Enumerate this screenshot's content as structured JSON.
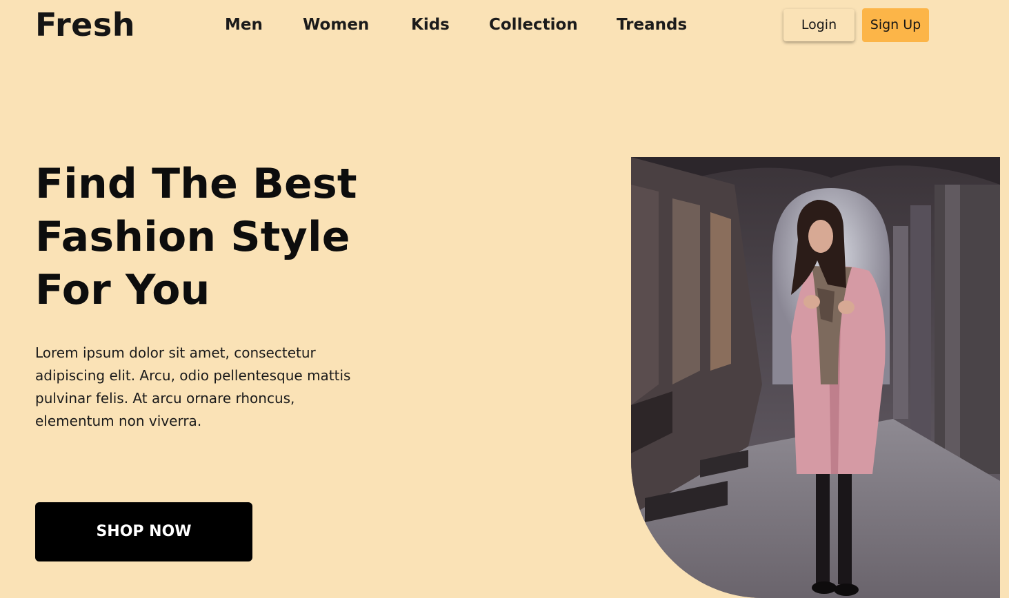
{
  "brand": {
    "logo_text": "Fresh"
  },
  "nav": {
    "items": [
      {
        "label": "Men"
      },
      {
        "label": "Women"
      },
      {
        "label": "Kids"
      },
      {
        "label": "Collection"
      },
      {
        "label": "Treands"
      }
    ]
  },
  "auth": {
    "login_label": "Login",
    "signup_label": "Sign Up"
  },
  "hero": {
    "title_lines": [
      "Find The Best",
      "Fashion Style",
      "For You"
    ],
    "description_lines": [
      "Lorem ipsum dolor sit amet, consectetur",
      "adipiscing elit. Arcu, odio pellentesque mattis",
      "pulvinar felis. At arcu ornare rhoncus,",
      "elementum non viverra."
    ],
    "cta_label": "SHOP NOW"
  },
  "colors": {
    "background": "#fae2b6",
    "signup_accent": "#fcb548",
    "cta_background": "#000000"
  }
}
